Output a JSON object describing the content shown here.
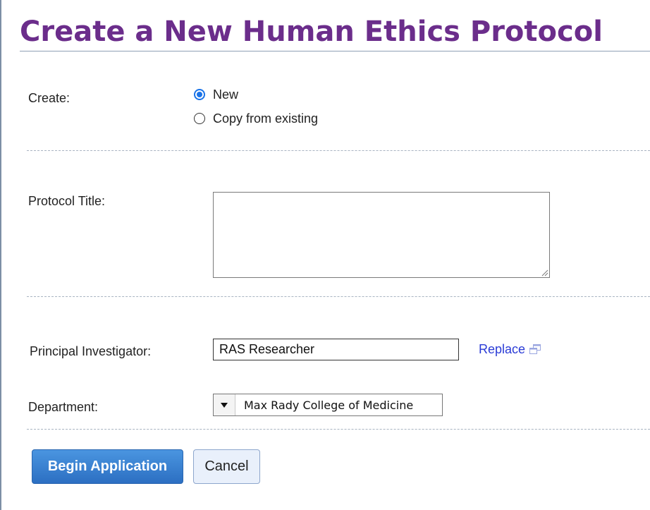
{
  "page": {
    "title": "Create a New Human Ethics Protocol"
  },
  "create": {
    "label": "Create:",
    "options": [
      {
        "label": "New",
        "selected": true
      },
      {
        "label": "Copy from existing",
        "selected": false
      }
    ]
  },
  "protocol_title": {
    "label": "Protocol Title:",
    "value": ""
  },
  "principal_investigator": {
    "label": "Principal Investigator:",
    "value": "RAS Researcher",
    "replace_label": "Replace",
    "replace_icon": "popup-window-icon"
  },
  "department": {
    "label": "Department:",
    "selected": "Max Rady College of Medicine"
  },
  "actions": {
    "begin_label": "Begin Application",
    "cancel_label": "Cancel"
  },
  "colors": {
    "title": "#6b2d8b",
    "link": "#2a3bd6",
    "primary_button": "#2c6fc2",
    "radio_accent": "#1a73e8"
  }
}
